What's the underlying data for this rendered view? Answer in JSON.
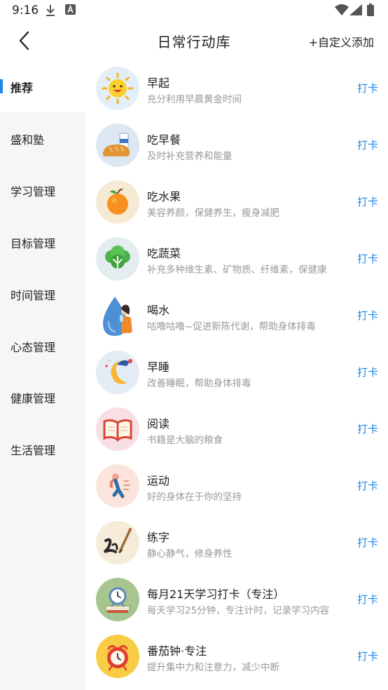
{
  "status_bar": {
    "time": "9:16",
    "icons": [
      "download-icon",
      "app-notification-icon",
      "wifi-icon",
      "signal-icon",
      "battery-icon"
    ]
  },
  "header": {
    "title": "日常行动库",
    "custom_add_label": "+自定义添加",
    "back_icon": "chevron-left-icon"
  },
  "sidebar": {
    "items": [
      {
        "label": "推荐",
        "active": true
      },
      {
        "label": "盛和塾",
        "active": false
      },
      {
        "label": "学习管理",
        "active": false
      },
      {
        "label": "目标管理",
        "active": false
      },
      {
        "label": "时间管理",
        "active": false
      },
      {
        "label": "心态管理",
        "active": false
      },
      {
        "label": "健康管理",
        "active": false
      },
      {
        "label": "生活管理",
        "active": false
      }
    ]
  },
  "actions": [
    {
      "title": "早起",
      "desc": "充分利用早晨黄金时间",
      "button": "打卡",
      "icon": "sun-icon"
    },
    {
      "title": "吃早餐",
      "desc": "及时补充营养和能量",
      "button": "打卡",
      "icon": "bread-milk-icon"
    },
    {
      "title": "吃水果",
      "desc": "美容养颜，保健养生，瘦身减肥",
      "button": "打卡",
      "icon": "orange-icon"
    },
    {
      "title": "吃蔬菜",
      "desc": "补充多种维生素、矿物质、纤维素，保健康",
      "button": "打卡",
      "icon": "vegetable-icon"
    },
    {
      "title": "喝水",
      "desc": "咕噜咕噜~促进新陈代谢，帮助身体排毒",
      "button": "打卡",
      "icon": "drinking-water-icon"
    },
    {
      "title": "早睡",
      "desc": "改善睡眠，帮助身体排毒",
      "button": "打卡",
      "icon": "moon-sleep-icon"
    },
    {
      "title": "阅读",
      "desc": "书籍是大脑的粮食",
      "button": "打卡",
      "icon": "open-book-icon"
    },
    {
      "title": "运动",
      "desc": "好的身体在于你的坚持",
      "button": "打卡",
      "icon": "exercise-icon"
    },
    {
      "title": "练字",
      "desc": "静心静气，修身养性",
      "button": "打卡",
      "icon": "calligraphy-brush-icon"
    },
    {
      "title": "每月21天学习打卡（专注）",
      "desc": "每天学习25分钟，专注计时，记录学习内容",
      "button": "打卡",
      "icon": "study-clock-icon"
    },
    {
      "title": "番茄钟·专注",
      "desc": "提升集中力和注意力，减少中断",
      "button": "打卡",
      "icon": "tomato-clock-icon"
    }
  ]
}
